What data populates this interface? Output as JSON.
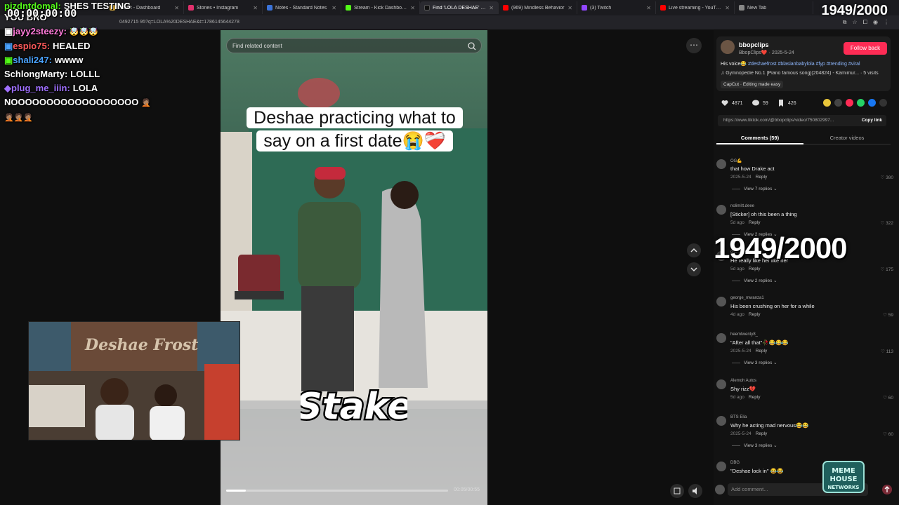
{
  "browser": {
    "tabs": [
      {
        "title": "Toolkit - Dashboard",
        "color": "#e3b341",
        "active": false
      },
      {
        "title": "Stories • Instagram",
        "color": "#e1306c",
        "active": false
      },
      {
        "title": "Notes - Standard Notes",
        "color": "#3b73d9",
        "active": false
      },
      {
        "title": "Stream - Kick Dashboard",
        "color": "#53fc18",
        "active": false
      },
      {
        "title": "Find 'LOLA DESHAE' on TikTok",
        "color": "#111111",
        "active": true
      },
      {
        "title": "(969) Mindless Behavior",
        "color": "#ff0000",
        "active": false
      },
      {
        "title": "(3) Twitch",
        "color": "#9146ff",
        "active": false
      },
      {
        "title": "Live streaming - YouTube Studio",
        "color": "#ff0000",
        "active": false
      },
      {
        "title": "New Tab",
        "color": "#888888",
        "active": false
      }
    ],
    "url": "0492715 95?q=LOLA%20DESHAE&t=1786145644278"
  },
  "overlay": {
    "timer": "00:00:00:00",
    "counter_top": "1949/2000",
    "counter_big": "1949/2000"
  },
  "chat": [
    {
      "user": "",
      "user_color": "#ffffff",
      "message": "YOU BRO",
      "emotes": ""
    },
    {
      "user": "jayy2steezy:",
      "user_color": "#ff7ad9",
      "message": "",
      "emotes": "🤯🤯🤯"
    },
    {
      "user": "espio75:",
      "user_color": "#ff5a5a",
      "message": "HEALED",
      "emotes": ""
    },
    {
      "user": "shali247:",
      "user_color": "#4aa3ff",
      "message": "wwww",
      "emotes": ""
    },
    {
      "user": "SchlongMarty:",
      "user_color": "#ffffff",
      "message": "LOLLL",
      "emotes": ""
    },
    {
      "user": "plug_me_iiin:",
      "user_color": "#a070ff",
      "message": "LOLA",
      "emotes": ""
    },
    {
      "user": "",
      "user_color": "#ffffff",
      "message": "NOOOOOOOOOOOOOOOOOO",
      "emotes": "🤦🏽"
    },
    {
      "user": "",
      "user_color": "#ffffff",
      "message": "",
      "emotes": "🤦🏽🤦🏽🤦🏽"
    }
  ],
  "chat_top": {
    "user1": "pizdntdomal:",
    "message1": "SHES TESTING"
  },
  "video": {
    "search_placeholder": "Find related content",
    "caption": "Deshae practicing what to say on a first date😭❤️‍🩹",
    "sponsor": "Stake",
    "time": "00:05/00:55",
    "progress": 0.09
  },
  "panel": {
    "author": "bbopclips",
    "author_sub": "BbopClips❤️ · 2025-5-24",
    "follow_label": "Follow back",
    "desc_text": "His voice😂 ",
    "desc_tags": "#deshaefrost #blasianbabylola #fyp #trending #viral",
    "music": "♫  Gymnopedie No.1 [Piano famous song](204824) - Kamimur... · 5 visits",
    "capcut": "CapCut · Editing made easy",
    "likes": "4871",
    "comments_count": "59",
    "saves": "426",
    "link": "https://www.tiktok.com/@bbopclips/video/750802997...",
    "copy_label": "Copy link",
    "tab_comments": "Comments (59)",
    "tab_creator": "Creator videos",
    "comment_placeholder": "Add comment..."
  },
  "comments": [
    {
      "user": "OG💪",
      "text": "that how Drake act",
      "date": "2025-5-24",
      "likes": "380",
      "replies": "View 7 replies ⌄"
    },
    {
      "user": "nolimitt.deee",
      "text": "[Sticker] oh this been a thing",
      "date": "5d ago",
      "likes": "322",
      "replies": "View 2 replies ⌄"
    },
    {
      "user": "GNN",
      "text": "He really like her like her",
      "date": "5d ago",
      "likes": "175",
      "replies": "View 2 replies ⌄"
    },
    {
      "user": "george_mwanza1",
      "text": "His been crushing on her for a while",
      "date": "4d ago",
      "likes": "59",
      "replies": ""
    },
    {
      "user": "heemtwenty8_",
      "text": "\"After all that\"🥀😂😂😂",
      "date": "2025-5-24",
      "likes": "113",
      "replies": "View 3 replies ⌄"
    },
    {
      "user": "Alemoh Autos",
      "text": "Shy rizz💔",
      "date": "5d ago",
      "likes": "60",
      "replies": ""
    },
    {
      "user": "BTS Elia",
      "text": "Why he acting mad nervous😂😂",
      "date": "2025-5-24",
      "likes": "60",
      "replies": "View 3 replies ⌄"
    },
    {
      "user": "DBG",
      "text": "\"Deshae lock in\" 😂😂",
      "date": "",
      "likes": "",
      "replies": ""
    }
  ],
  "watermark": "MEME HOUSE NETWORKS",
  "reply_label": "Reply"
}
